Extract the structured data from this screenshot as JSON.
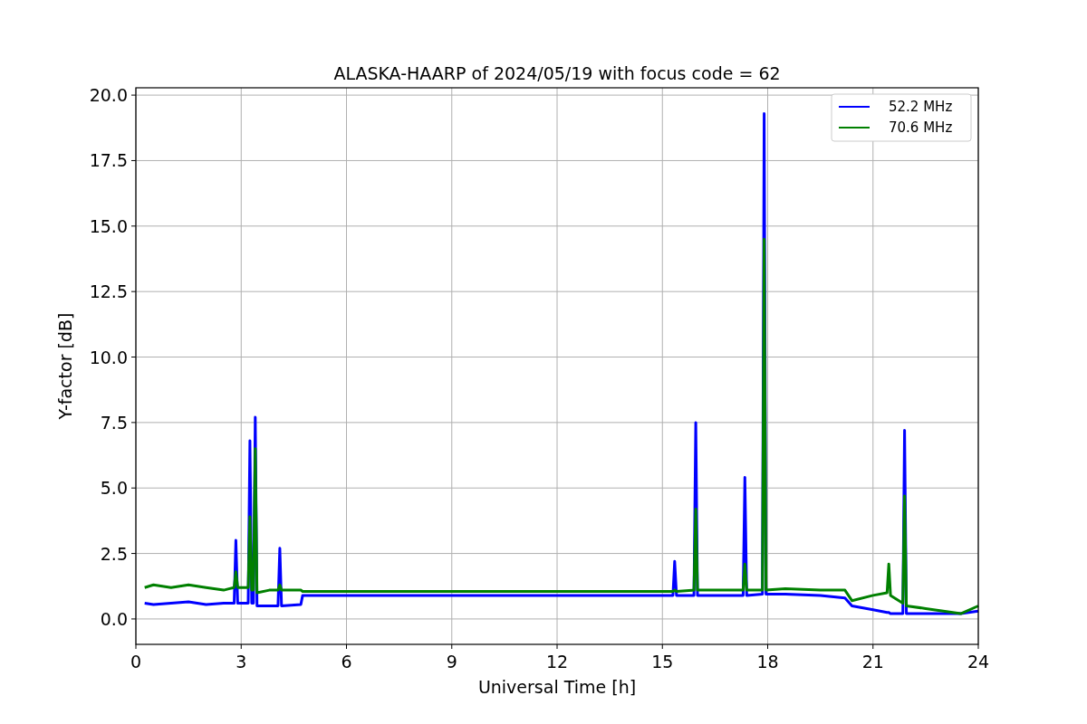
{
  "figure": {
    "chart_data": {
      "type": "line",
      "title": "ALASKA-HAARP of 2024/05/19 with focus code = 62",
      "xlabel": "Universal Time [h]",
      "ylabel": "Y-factor [dB]",
      "x": [
        0.25,
        0.5,
        1,
        1.5,
        2,
        2.5,
        2.8,
        2.85,
        2.9,
        3.2,
        3.25,
        3.3,
        3.35,
        3.4,
        3.45,
        3.8,
        4.05,
        4.1,
        4.15,
        4.7,
        4.75,
        14.5,
        15.3,
        15.35,
        15.4,
        15.9,
        15.95,
        16,
        17,
        17.3,
        17.35,
        17.4,
        17.85,
        17.9,
        17.95,
        18.5,
        19.5,
        20.2,
        20.4,
        21,
        21.4,
        21.45,
        21.5,
        21.85,
        21.9,
        21.95,
        22.5,
        23,
        23.5,
        24
      ],
      "series": [
        {
          "name": "52.2 MHz",
          "color": "#0000ff",
          "values": [
            0.6,
            0.55,
            0.6,
            0.65,
            0.55,
            0.6,
            0.6,
            3.0,
            0.6,
            0.6,
            6.8,
            0.6,
            0.6,
            7.7,
            0.5,
            0.5,
            0.5,
            2.7,
            0.5,
            0.55,
            0.9,
            0.9,
            0.9,
            2.2,
            0.9,
            0.9,
            7.5,
            0.9,
            0.9,
            0.9,
            5.4,
            0.9,
            0.95,
            19.3,
            0.95,
            0.95,
            0.9,
            0.8,
            0.5,
            0.35,
            0.25,
            0.25,
            0.2,
            0.2,
            7.2,
            0.2,
            0.2,
            0.2,
            0.2,
            0.3
          ]
        },
        {
          "name": "70.6 MHz",
          "color": "#008000",
          "values": [
            1.2,
            1.3,
            1.2,
            1.3,
            1.2,
            1.1,
            1.2,
            1.8,
            1.2,
            1.2,
            3.9,
            1.1,
            1.1,
            6.5,
            1.0,
            1.1,
            1.1,
            1.3,
            1.1,
            1.1,
            1.05,
            1.05,
            1.05,
            1.1,
            1.05,
            1.1,
            4.2,
            1.1,
            1.1,
            1.1,
            2.1,
            1.1,
            1.1,
            14.5,
            1.1,
            1.15,
            1.1,
            1.1,
            0.7,
            0.9,
            1.0,
            2.1,
            0.9,
            0.6,
            4.7,
            0.5,
            0.4,
            0.3,
            0.2,
            0.5
          ]
        }
      ],
      "grid": true,
      "legend": "upper right",
      "xlim": [
        0,
        24
      ],
      "ylim": [
        -0.97,
        20.28
      ],
      "xticks": [
        0,
        3,
        6,
        9,
        12,
        15,
        18,
        21,
        24
      ],
      "yticks": [
        {
          "value": 0,
          "label": "0.0"
        },
        {
          "value": 2.5,
          "label": "2.5"
        },
        {
          "value": 5,
          "label": "5.0"
        },
        {
          "value": 7.5,
          "label": "7.5"
        },
        {
          "value": 10,
          "label": "10.0"
        },
        {
          "value": 12.5,
          "label": "12.5"
        },
        {
          "value": 15,
          "label": "15.0"
        },
        {
          "value": 17.5,
          "label": "17.5"
        },
        {
          "value": 20,
          "label": "20.0"
        }
      ]
    }
  }
}
